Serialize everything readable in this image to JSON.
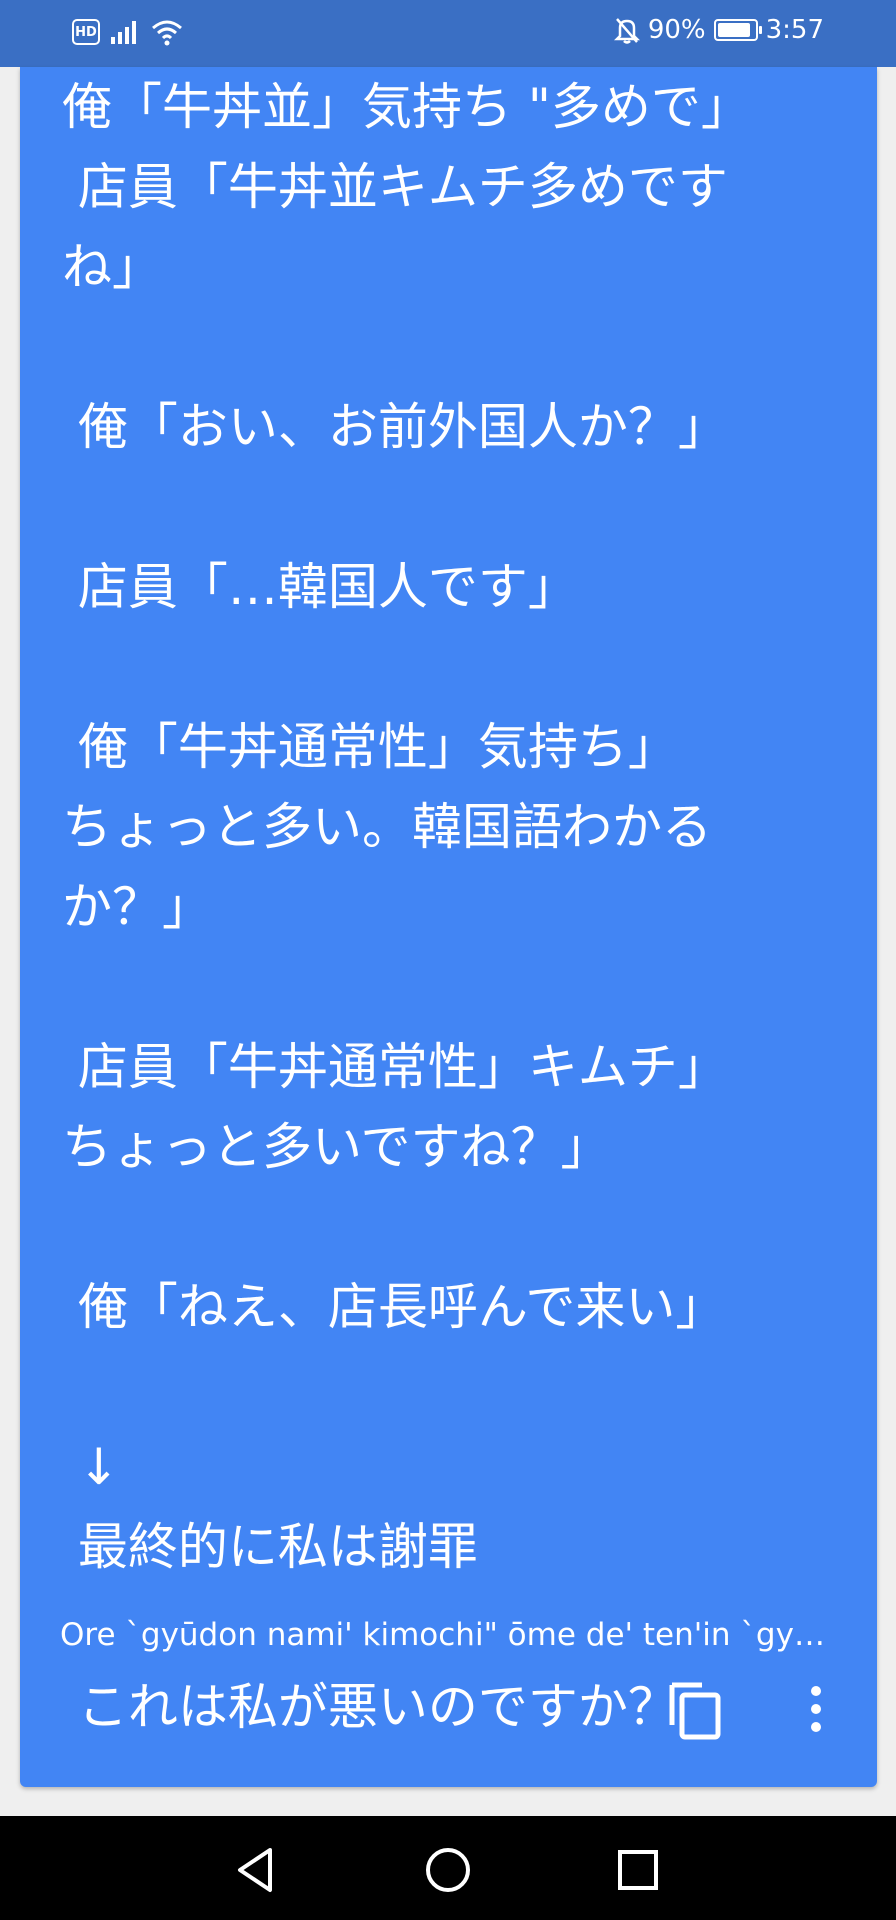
{
  "status_bar": {
    "hd_label": "HD",
    "battery_percent_label": "90%",
    "battery_level": 0.9,
    "time": "3:57",
    "icons": [
      "hd-icon",
      "cellular-signal-icon",
      "wifi-icon",
      "bell-off-icon",
      "battery-saver-icon"
    ]
  },
  "card": {
    "translation_text": "俺「牛丼並」気持ち \"多めで」\n 店員「牛丼並キムチ多めです\nね」\n\n 俺「おい、お前外国人か？」\n\n 店員「…韓国人です」\n\n 俺「牛丼通常性」気持ち」\nちょっと多い。韓国語わかる\nか？」\n\n 店員「牛丼通常性」キムチ」\nちょっと多いですね？」\n\n 俺「ねえ、店長呼んで来い」\n\n ↓\n 最終的に私は謝罪\n\n これは私が悪いのですか？",
    "transliteration": "Ore `gyūdon nami' kimochi\" ōme de' ten'in `gyūdon nami kimuchi ōmedesu ne'",
    "actions": [
      "copy-icon",
      "more-vert-icon"
    ],
    "background_color": "#4285f4"
  },
  "nav_bar": {
    "buttons": [
      "back-icon",
      "home-icon",
      "recent-apps-icon"
    ]
  },
  "colors": {
    "status_bar": "#3a6fc4",
    "card": "#4285f4",
    "page_background": "#efefef",
    "nav_bar": "#000000"
  }
}
